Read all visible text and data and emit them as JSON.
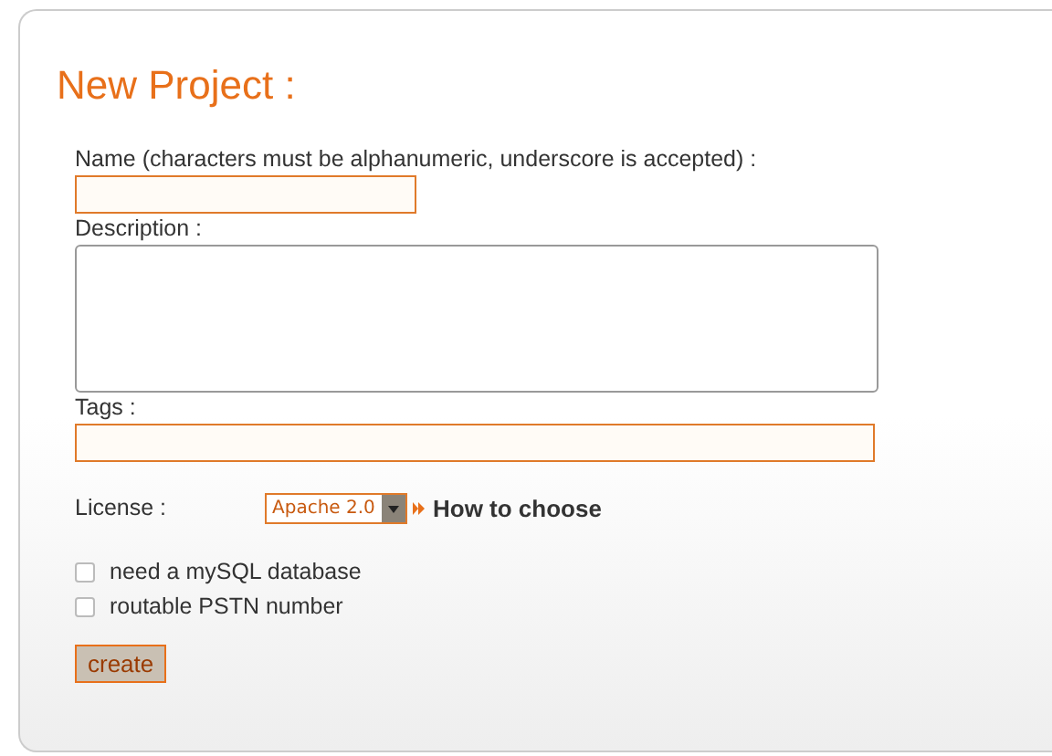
{
  "title": "New Project :",
  "fields": [
    {
      "kind": "short",
      "label": "Name (characters must be alphanumeric, underscore is accepted) :"
    },
    {
      "kind": "textarea",
      "label": "Description :"
    },
    {
      "kind": "wide",
      "label": "Tags :"
    }
  ],
  "license": {
    "label": "License :",
    "value": "Apache 2.0",
    "link": "How to choose"
  },
  "options": [
    {
      "label": "need a mySQL database",
      "checked": false
    },
    {
      "label": "routable PSTN number",
      "checked": false
    }
  ],
  "button": "create"
}
